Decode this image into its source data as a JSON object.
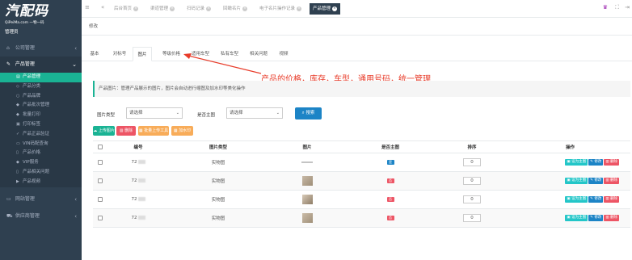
{
  "brand": {
    "logo": "汽配码",
    "sub": "QiPeiMa.com 一物一码",
    "role": "管理员"
  },
  "colors": {
    "sidebar": "#2f4050",
    "accent": "#1ab394",
    "primary": "#1c84c6",
    "danger": "#ed5565",
    "warning": "#f8ac59",
    "info": "#23c6c8",
    "annotation": "#e83c2a"
  },
  "menu": {
    "groups": [
      {
        "label": "公司管理",
        "icon": "home-icon"
      },
      {
        "label": "产品管理",
        "icon": "wrench-icon",
        "open": true
      }
    ],
    "product_items": [
      {
        "label": "产品管理",
        "icon": "list-icon",
        "active": true
      },
      {
        "label": "产品分类",
        "icon": "tag-icon"
      },
      {
        "label": "产品品牌",
        "icon": "circle-icon"
      },
      {
        "label": "产品批次管理",
        "icon": "shield-icon"
      },
      {
        "label": "批量打印",
        "icon": "shield-icon"
      },
      {
        "label": "打印标签",
        "icon": "print-icon"
      },
      {
        "label": "产品正品验证",
        "icon": "check-icon"
      },
      {
        "label": "VIN码配查询",
        "icon": "car-icon"
      },
      {
        "label": "产品价格",
        "icon": "doc-icon"
      },
      {
        "label": "VIP服务",
        "icon": "shield-icon"
      },
      {
        "label": "产品相关问题",
        "icon": "doc-icon"
      },
      {
        "label": "产品视频",
        "icon": "video-icon"
      }
    ],
    "bottom_groups": [
      {
        "label": "网站管理",
        "icon": "monitor-icon"
      },
      {
        "label": "供应商管理",
        "icon": "truck-icon"
      }
    ]
  },
  "topbar": {
    "tabs": [
      {
        "label": "后台首页"
      },
      {
        "label": "渠道管理"
      },
      {
        "label": "扫码记录"
      },
      {
        "label": "回瞰名片"
      },
      {
        "label": "电子名片操作记录"
      },
      {
        "label": "产品管理",
        "active": true
      }
    ]
  },
  "page": {
    "title": "修改"
  },
  "subtabs": [
    "基本",
    "对标号",
    "图片",
    "等级价格",
    "适用车型",
    "私有车型",
    "相关问题",
    "视频"
  ],
  "active_subtab": "图片",
  "annotation": "产品的价格，库存，车型，通用号码，统一管理",
  "info": "产品图片：管理产品展示的图片，图片会自动进行缩图及加水印等美化操作",
  "filters": {
    "type_label": "图片类型",
    "type_value": "请选择",
    "main_label": "是否主图",
    "main_value": "请选择",
    "search": "搜索"
  },
  "actions": {
    "upload": "上传图片",
    "delete": "删除",
    "batch_upload": "批量上传工具",
    "water_mark": "加水印"
  },
  "table": {
    "headers": [
      "编号",
      "图片类型",
      "图片",
      "是否主图",
      "排序",
      "操作"
    ],
    "rows": [
      {
        "id": "72",
        "type": "实物图",
        "main": "是",
        "sort": "0"
      },
      {
        "id": "72",
        "type": "实物图",
        "main": "否",
        "sort": "0"
      },
      {
        "id": "72",
        "type": "实物图",
        "main": "否",
        "sort": "0"
      },
      {
        "id": "72",
        "type": "实物图",
        "main": "否",
        "sort": "0"
      }
    ],
    "ops": {
      "set_main": "设为主图",
      "edit": "修改",
      "delete": "删除"
    }
  }
}
